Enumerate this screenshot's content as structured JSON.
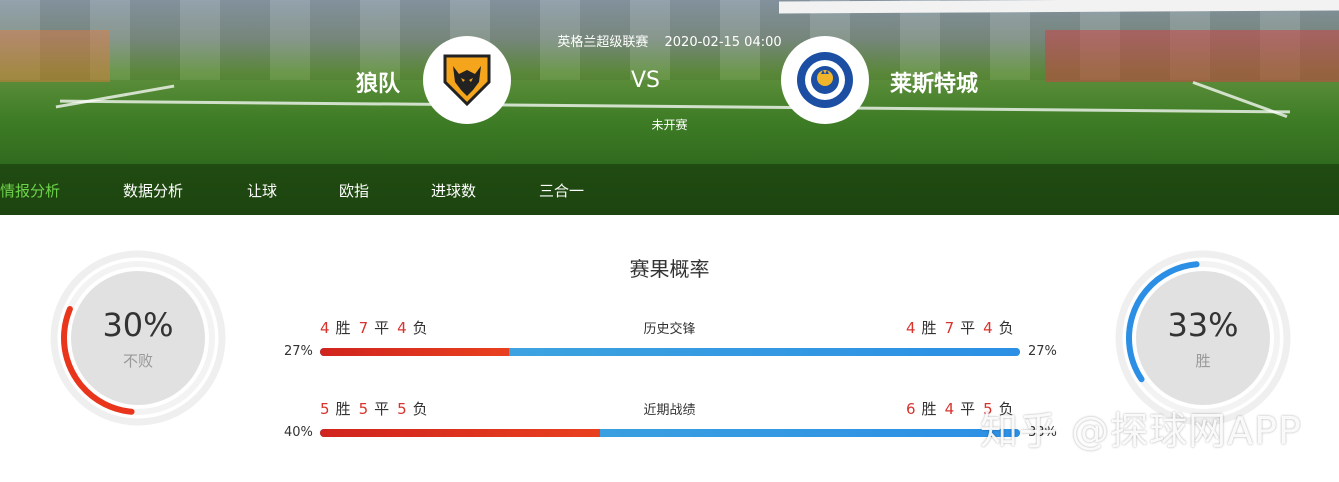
{
  "match": {
    "league": "英格兰超级联赛",
    "datetime": "2020-02-15 04:00",
    "vs": "VS",
    "status": "未开赛",
    "home": {
      "name": "狼队",
      "badge_icon": "wolves-crest-icon"
    },
    "away": {
      "name": "莱斯特城",
      "badge_icon": "leicester-crest-icon"
    }
  },
  "tabs": [
    {
      "label": "情报分析",
      "active": true
    },
    {
      "label": "数据分析",
      "active": false
    },
    {
      "label": "让球",
      "active": false
    },
    {
      "label": "欧指",
      "active": false
    },
    {
      "label": "进球数",
      "active": false
    },
    {
      "label": "三合一",
      "active": false
    }
  ],
  "probability": {
    "title": "赛果概率",
    "home": {
      "pct": "30%",
      "label": "不败",
      "fraction": 0.3,
      "color": "#e8351c"
    },
    "away": {
      "pct": "33%",
      "label": "胜",
      "fraction": 0.33,
      "color": "#2b8fe5"
    },
    "rows": [
      {
        "label": "历史交锋",
        "home": {
          "w": "4",
          "d": "7",
          "l": "4",
          "pct": "27%",
          "fraction": 0.27
        },
        "away": {
          "w": "4",
          "d": "7",
          "l": "4",
          "pct": "27%"
        },
        "win_char": "胜",
        "draw_char": "平",
        "loss_char": "负"
      },
      {
        "label": "近期战绩",
        "home": {
          "w": "5",
          "d": "5",
          "l": "5",
          "pct": "40%",
          "fraction": 0.4
        },
        "away": {
          "w": "6",
          "d": "4",
          "l": "5",
          "pct": "33%"
        },
        "win_char": "胜",
        "draw_char": "平",
        "loss_char": "负"
      }
    ]
  },
  "watermark": "知乎 @探球网APP"
}
